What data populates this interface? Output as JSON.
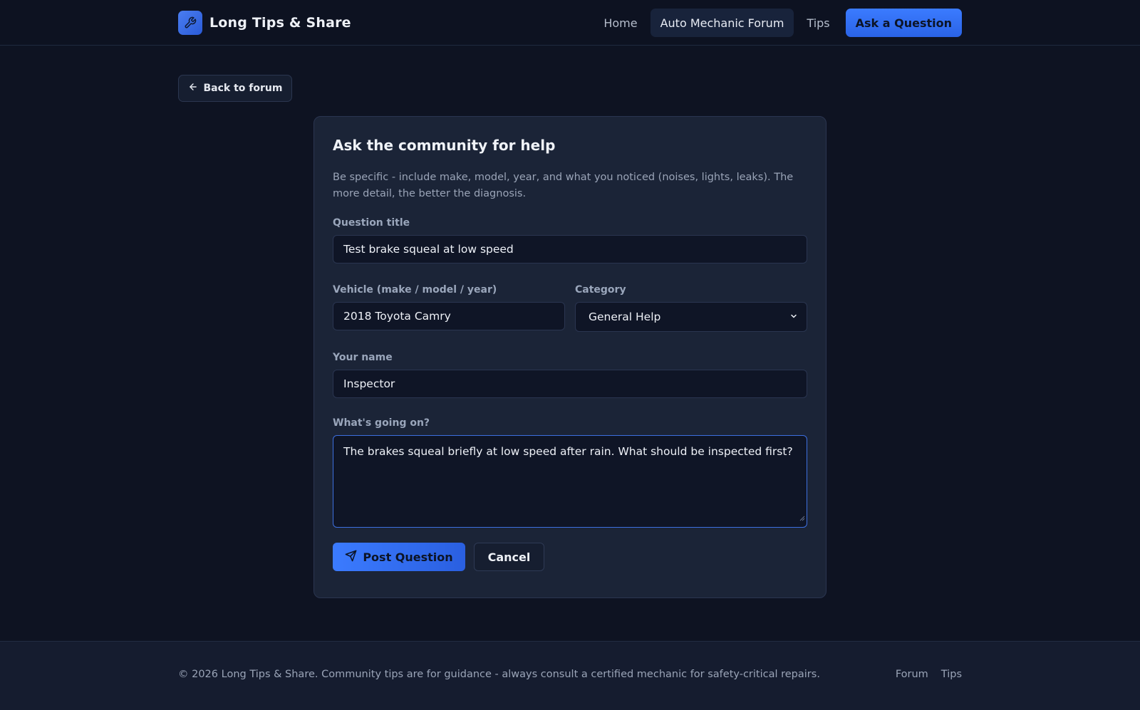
{
  "header": {
    "brand_name": "Long Tips & Share",
    "brand_icon": "wrench-icon",
    "nav": {
      "home": "Home",
      "forum": "Auto Mechanic Forum",
      "tips": "Tips",
      "ask": "Ask a Question"
    }
  },
  "back_button": {
    "label": "Back to forum",
    "icon": "arrow-left-icon"
  },
  "form": {
    "title": "Ask the community for help",
    "description": "Be specific - include make, model, year, and what you noticed (noises, lights, leaks). The more detail, the better the diagnosis.",
    "question_title": {
      "label": "Question title",
      "value": "Test brake squeal at low speed"
    },
    "vehicle": {
      "label": "Vehicle (make / model / year)",
      "value": "2018 Toyota Camry"
    },
    "category": {
      "label": "Category",
      "value": "General Help"
    },
    "name": {
      "label": "Your name",
      "value": "Inspector"
    },
    "details": {
      "label": "What's going on?",
      "value": "The brakes squeal briefly at low speed after rain. What should be inspected first?"
    },
    "post_label": "Post Question",
    "post_icon": "send-icon",
    "cancel_label": "Cancel"
  },
  "footer": {
    "text": "© 2026 Long Tips & Share. Community tips are for guidance - always consult a certified mechanic for safety-critical repairs.",
    "links": {
      "forum": "Forum",
      "tips": "Tips"
    }
  },
  "colors": {
    "accent": "#3b7bff",
    "background": "#0e1322",
    "card": "#1b2437"
  }
}
